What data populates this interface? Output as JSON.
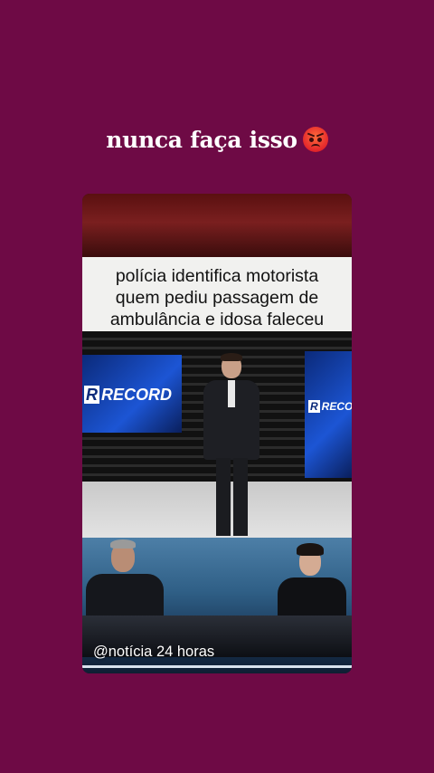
{
  "story": {
    "text": "nunca faça isso"
  },
  "video": {
    "caption_lines": [
      "polícia identifica motorista",
      "quem pediu passagem de",
      "ambulância e idosa faleceu"
    ],
    "logo_left": "RECORD",
    "logo_right": "RECO",
    "watermark": "@notícia 24 horas"
  },
  "icons": {
    "emoji": "angry-face-icon"
  }
}
